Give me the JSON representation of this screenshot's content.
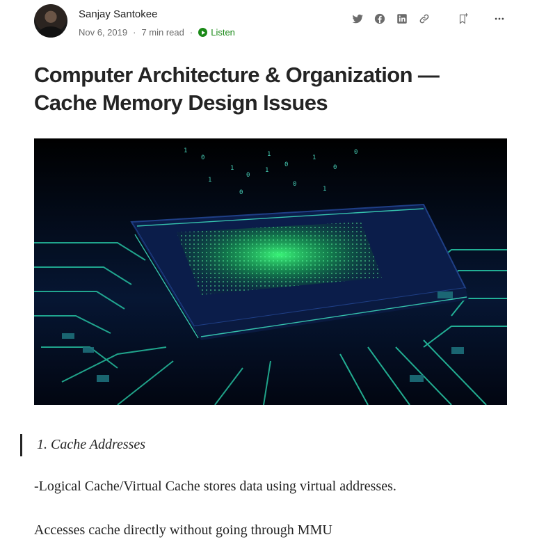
{
  "author": {
    "name": "Sanjay Santokee",
    "date": "Nov 6, 2019",
    "read_time": "7 min read",
    "separator": "·",
    "listen_label": "Listen"
  },
  "actions": {
    "icons": [
      "twitter-icon",
      "facebook-icon",
      "linkedin-icon",
      "link-icon",
      "bookmark-add-icon",
      "more-icon"
    ],
    "color": "#6b6b6b"
  },
  "article": {
    "title_line1": "Computer Architecture & Organization —",
    "title_line2": "Cache Memory Design Issues",
    "hero_image": "circuit-board-cpu-chip-green-glow",
    "quote": "1. Cache Addresses",
    "paragraphs": [
      "-Logical Cache/Virtual Cache stores data using virtual addresses.",
      "Accesses cache directly without going through MMU"
    ]
  },
  "colors": {
    "listen": "#1a8917",
    "text": "#242424",
    "meta": "#6b6b6b",
    "glow": "#39ff7a"
  }
}
